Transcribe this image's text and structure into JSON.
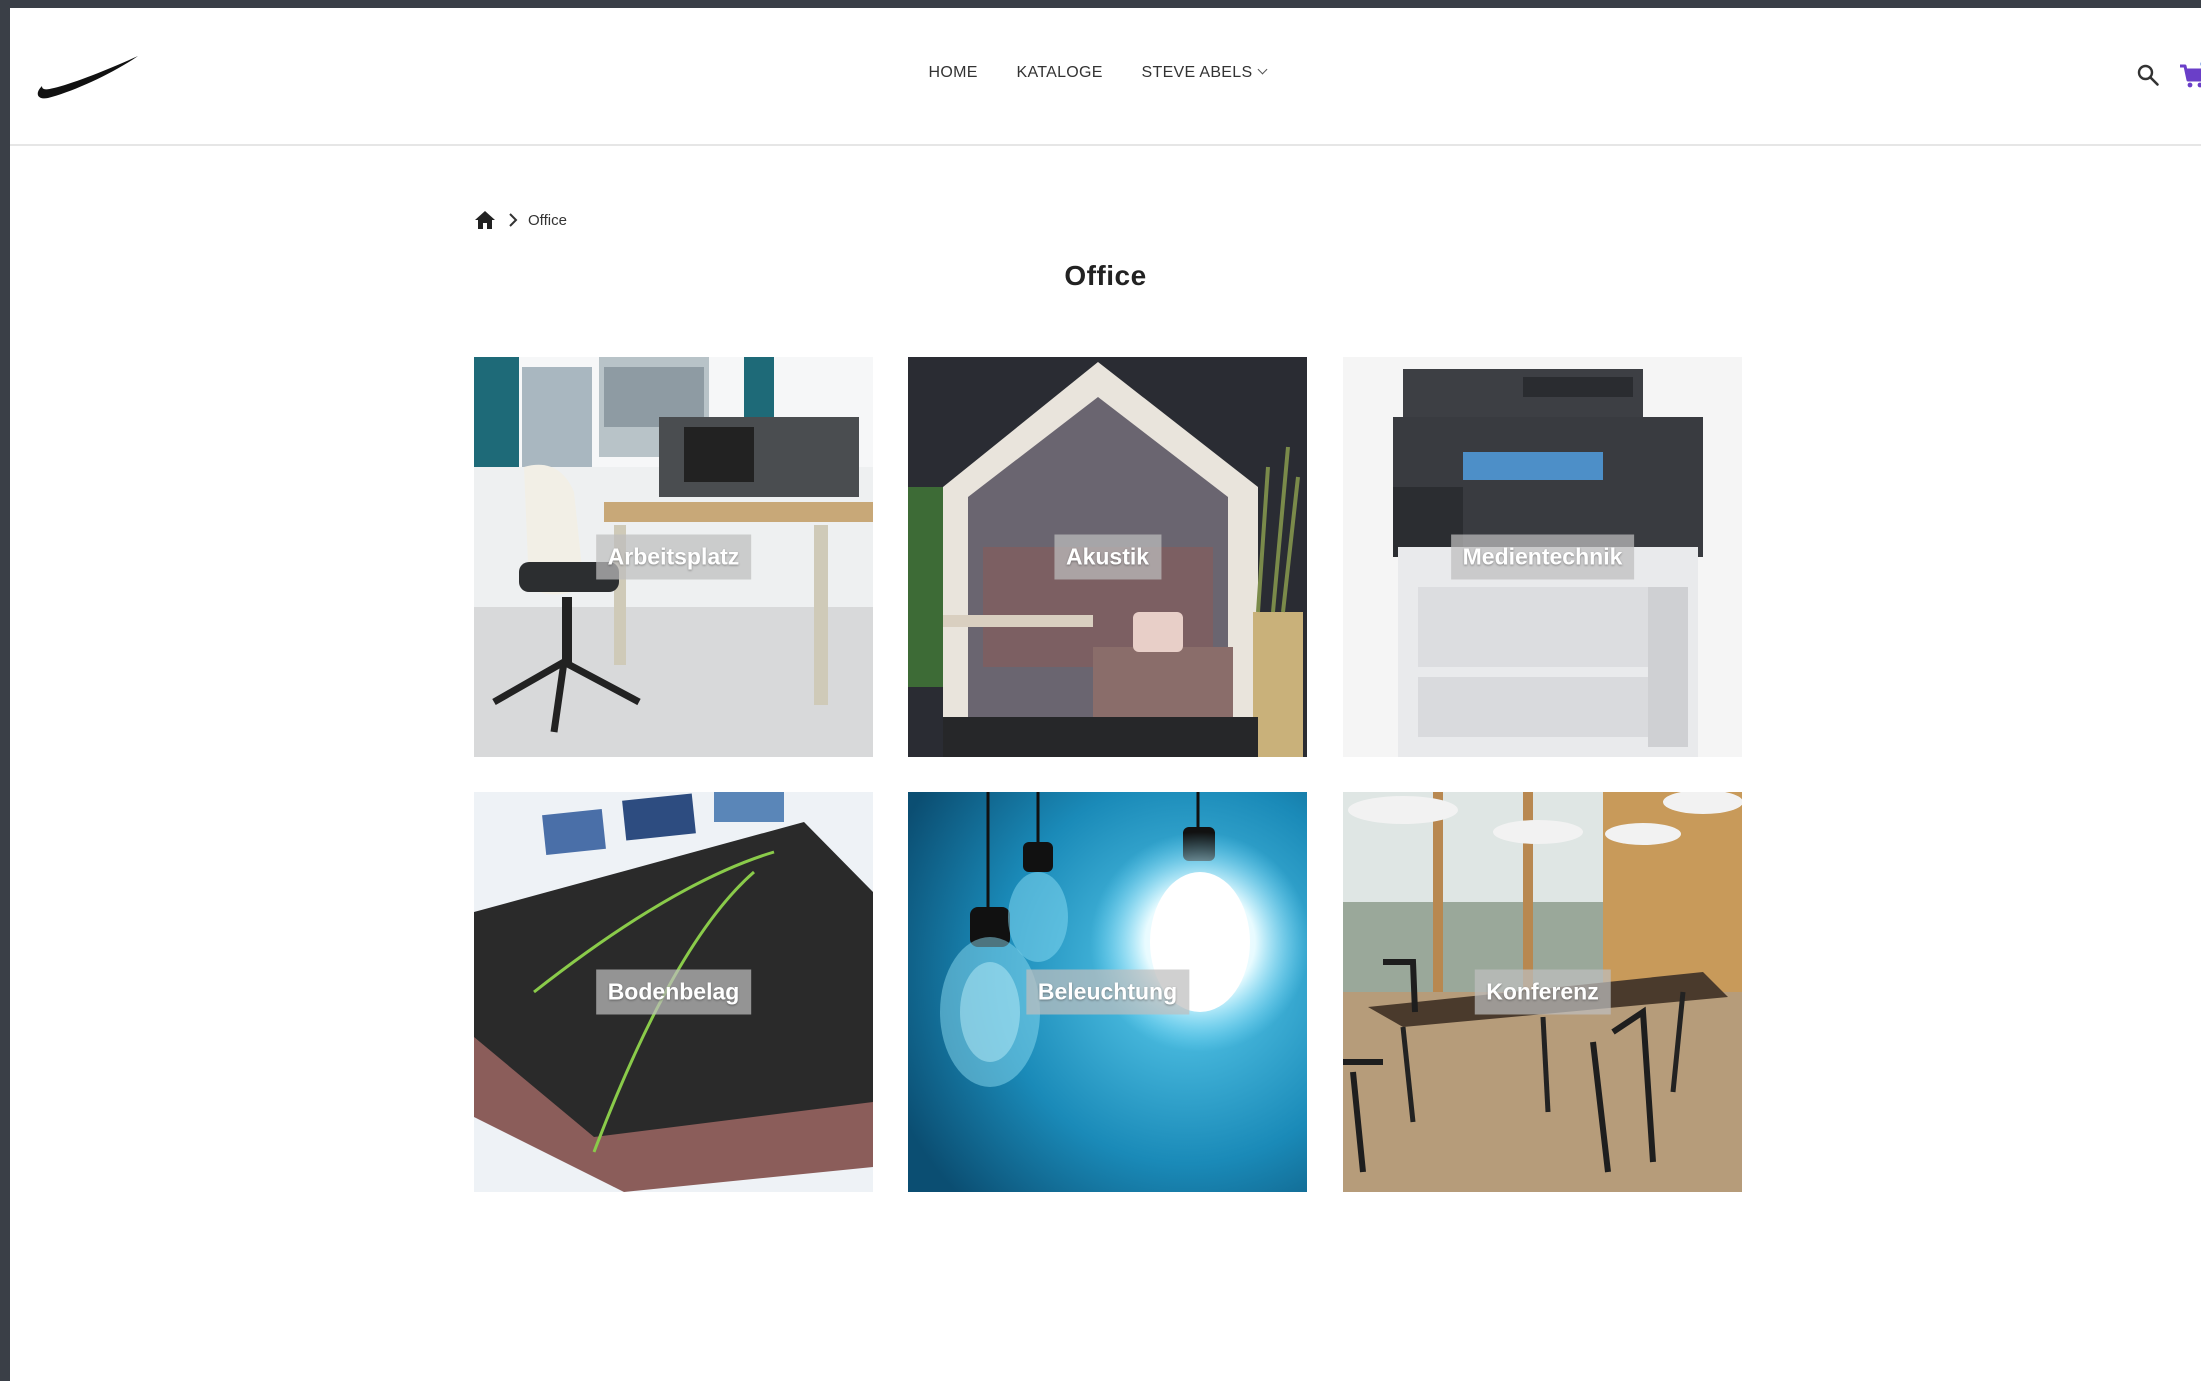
{
  "header": {
    "nav": [
      {
        "label": "HOME"
      },
      {
        "label": "KATALOGE"
      },
      {
        "label": "STEVE ABELS"
      }
    ]
  },
  "breadcrumb": {
    "current": "Office"
  },
  "page": {
    "title": "Office"
  },
  "categories": [
    {
      "label": "Arbeitsplatz"
    },
    {
      "label": "Akustik"
    },
    {
      "label": "Medientechnik"
    },
    {
      "label": "Bodenbelag"
    },
    {
      "label": "Beleuchtung"
    },
    {
      "label": "Konferenz"
    }
  ],
  "colors": {
    "cart_accent": "#6a3fc8",
    "text": "#333333",
    "border": "#e6e6e6"
  }
}
